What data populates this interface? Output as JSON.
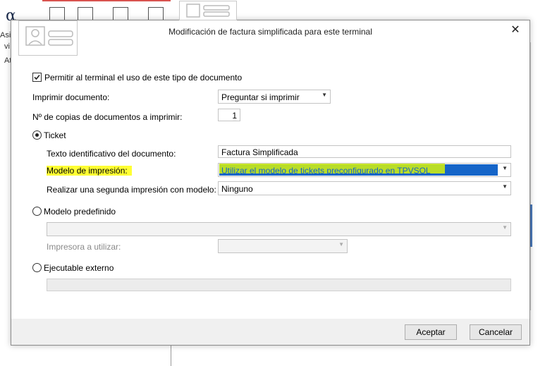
{
  "background": {
    "icon_glyph": "α",
    "fragments": [
      "Asi",
      "vi",
      "At"
    ]
  },
  "dialog": {
    "title": "Modificación de factura simplificada para este terminal",
    "close_glyph": "✕",
    "allow_checkbox": {
      "label": "Permitir al terminal el uso de este tipo de documento",
      "checked": true
    },
    "print_document": {
      "label": "Imprimir documento:",
      "value": "Preguntar si imprimir"
    },
    "copies": {
      "label": "Nº de copias de documentos a imprimir:",
      "value": "1"
    },
    "ticket": {
      "label": "Ticket",
      "selected": true,
      "identifier": {
        "label": "Texto identificativo del documento:",
        "value": "Factura Simplificada"
      },
      "print_model": {
        "label": "Modelo de impresión:",
        "value": "Utilizar el modelo de tickets preconfigurado en TPVSOL"
      },
      "second_print": {
        "label": "Realizar una segunda impresión con modelo:",
        "value": "Ninguno"
      }
    },
    "predefined": {
      "label": "Modelo predefinido",
      "selected": false,
      "model_value": "",
      "printer_label": "Impresora a utilizar:",
      "printer_value": ""
    },
    "external": {
      "label": "Ejecutable externo",
      "selected": false,
      "path_value": ""
    },
    "buttons": {
      "accept": "Aceptar",
      "cancel": "Cancelar"
    },
    "highlight_color": "#ffff33",
    "selection_color": "#1565c8"
  }
}
